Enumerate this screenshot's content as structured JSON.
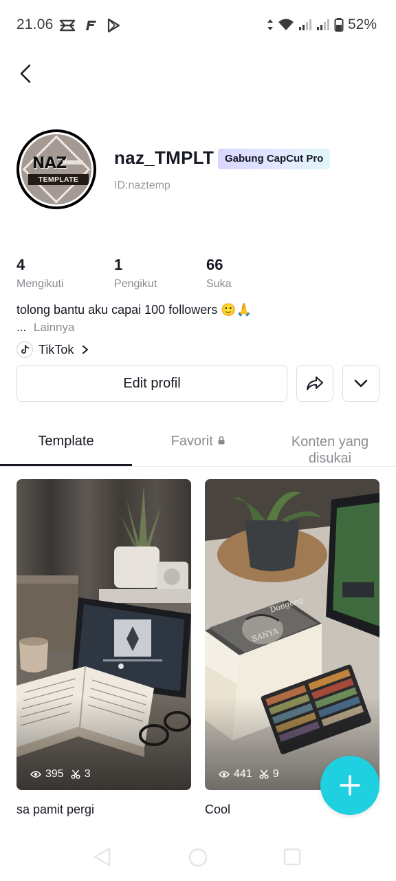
{
  "status_bar": {
    "time": "21.06",
    "battery": "52%"
  },
  "profile": {
    "avatar_text_top": "NAZ",
    "avatar_text_bottom": "TEMPLATE",
    "username": "naz_TMPLT",
    "pro_badge": "Gabung CapCut Pro",
    "user_id": "ID:naztemp"
  },
  "stats": [
    {
      "value": "4",
      "label": "Mengikuti"
    },
    {
      "value": "1",
      "label": "Pengikut"
    },
    {
      "value": "66",
      "label": "Suka"
    }
  ],
  "bio": {
    "text": "tolong bantu aku capai 100 followers 🙂🙏",
    "ellipsis": "...",
    "more": "Lainnya"
  },
  "link": {
    "label": "TikTok",
    "icon": "tiktok-icon"
  },
  "actions": {
    "edit_label": "Edit profil",
    "share_icon": "share-icon",
    "more_icon": "chevron-down-icon"
  },
  "tabs": [
    {
      "label": "Template",
      "active": true
    },
    {
      "label": "Favorit",
      "icon": "lock-icon",
      "active": false
    },
    {
      "label": "Konten yang disukai",
      "active": false
    }
  ],
  "templates": [
    {
      "title": "sa pamit pergi",
      "views": "395",
      "uses": "3"
    },
    {
      "title": "Cool",
      "views": "441",
      "uses": "9"
    }
  ],
  "colors": {
    "accent": "#1fd0e0",
    "text": "#161823",
    "secondary": "#8a8b91"
  }
}
